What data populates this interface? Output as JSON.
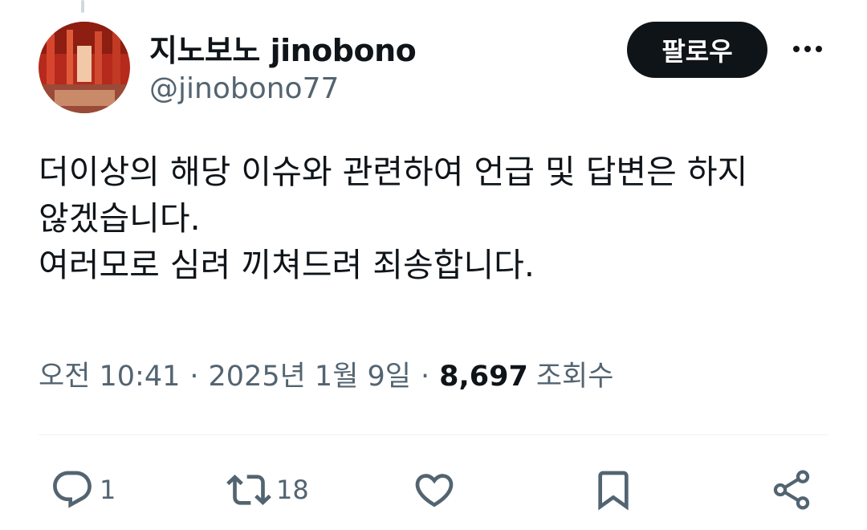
{
  "author": {
    "display_name": "지노보노 jinobono",
    "handle": "@jinobono77"
  },
  "header": {
    "follow_label": "팔로우",
    "more_icon": "more-horizontal-icon"
  },
  "tweet": {
    "lines": [
      "더이상의 해당 이슈와 관련하여 언급 및 답변은 하지",
      "않겠습니다.",
      "여러모로 심려 끼쳐드려 죄송합니다."
    ]
  },
  "meta": {
    "time": "오전 10:41",
    "separator": "·",
    "date": "2025년 1월 9일",
    "views_count": "8,697",
    "views_label": "조회수"
  },
  "actions": {
    "reply": {
      "icon": "reply-icon",
      "count": "1"
    },
    "retweet": {
      "icon": "retweet-icon",
      "count": "18"
    },
    "like": {
      "icon": "heart-icon"
    },
    "bookmark": {
      "icon": "bookmark-icon"
    },
    "share": {
      "icon": "share-icon"
    }
  },
  "colors": {
    "text_primary": "#0f1419",
    "text_secondary": "#536471",
    "button_bg": "#0f1419",
    "divider": "#eff3f4"
  }
}
